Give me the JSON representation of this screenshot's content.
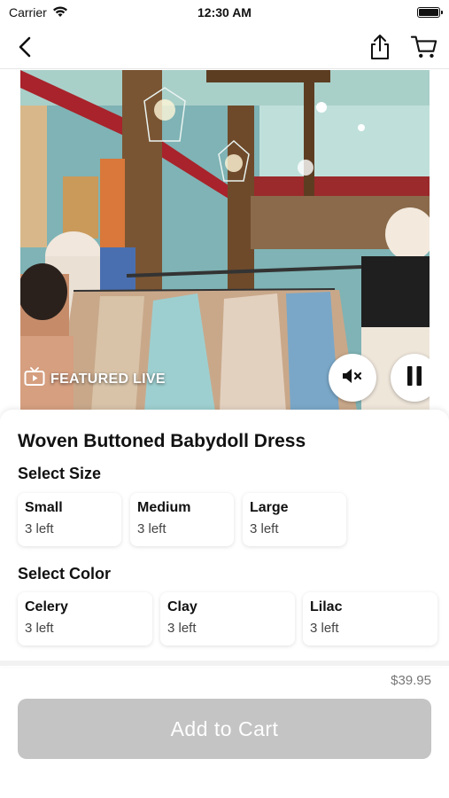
{
  "status_bar": {
    "carrier": "Carrier",
    "time": "12:30 AM",
    "icons": [
      "wifi-icon",
      "battery-icon"
    ]
  },
  "nav": {
    "icons": [
      "back-chevron-icon",
      "share-icon",
      "cart-icon"
    ]
  },
  "video": {
    "badge_label": "FEATURED LIVE",
    "badge_icon": "tv-play-icon",
    "controls": [
      "mute-icon",
      "pause-icon"
    ]
  },
  "product": {
    "title": "Woven Buttoned Babydoll Dress",
    "size_label": "Select Size",
    "sizes": [
      {
        "name": "Small",
        "stock": "3 left"
      },
      {
        "name": "Medium",
        "stock": "3 left"
      },
      {
        "name": "Large",
        "stock": "3 left"
      }
    ],
    "color_label": "Select Color",
    "colors": [
      {
        "name": "Celery",
        "stock": "3 left"
      },
      {
        "name": "Clay",
        "stock": "3 left"
      },
      {
        "name": "Lilac",
        "stock": "3 left"
      }
    ],
    "price": "$39.95",
    "add_to_cart_label": "Add to Cart"
  },
  "theme": {
    "button_disabled": "#c4c4c4",
    "price_text": "#777777"
  }
}
